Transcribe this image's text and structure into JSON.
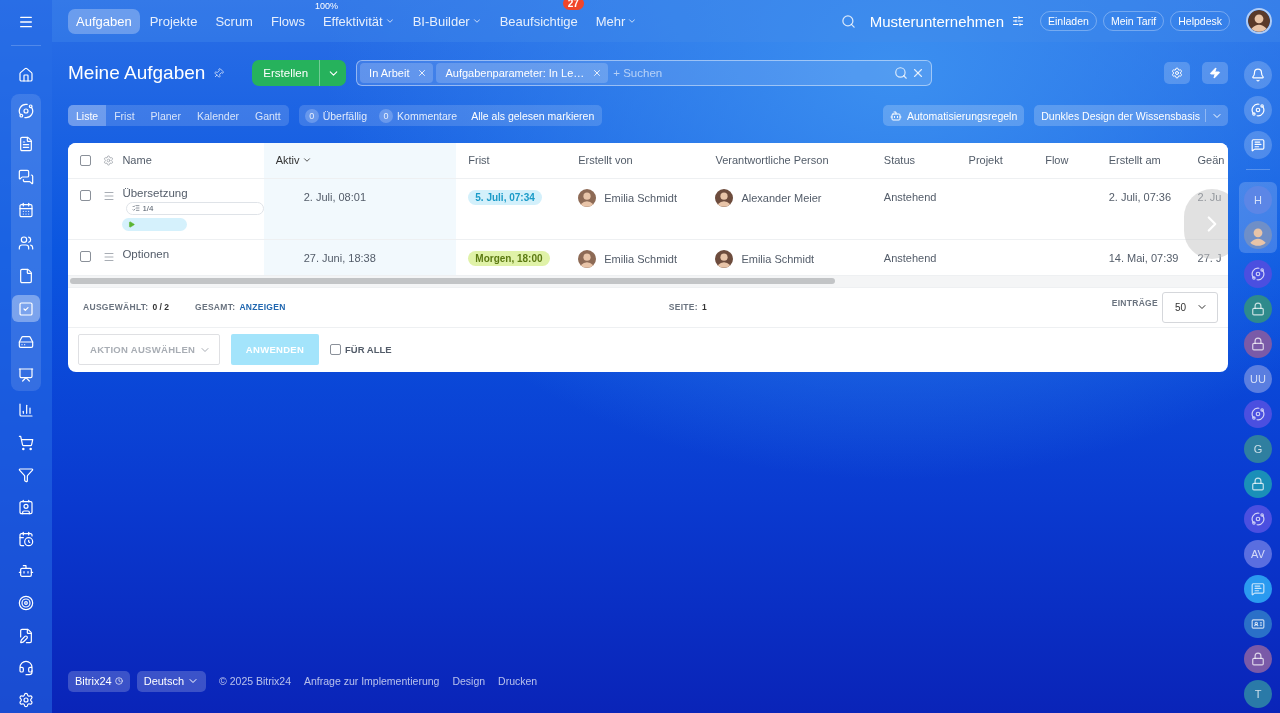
{
  "left_sidebar": {
    "top": [
      {
        "kind": "home",
        "selected": false
      }
    ],
    "group": [
      {
        "kind": "flow",
        "selected": false
      },
      {
        "kind": "news",
        "selected": false
      },
      {
        "kind": "chat",
        "selected": false
      },
      {
        "kind": "calendar",
        "selected": false
      },
      {
        "kind": "people",
        "selected": false
      },
      {
        "kind": "document",
        "selected": false
      },
      {
        "kind": "tasks",
        "selected": true
      },
      {
        "kind": "drive",
        "selected": false
      },
      {
        "kind": "board",
        "selected": false
      }
    ],
    "bottom": [
      {
        "kind": "chart",
        "selected": false
      },
      {
        "kind": "cart",
        "selected": false
      },
      {
        "kind": "funnel",
        "selected": false
      },
      {
        "kind": "contact",
        "selected": false
      },
      {
        "kind": "schedule",
        "selected": false
      },
      {
        "kind": "robot",
        "selected": false
      },
      {
        "kind": "target",
        "selected": false
      },
      {
        "kind": "sign",
        "selected": false
      },
      {
        "kind": "support",
        "selected": false
      },
      {
        "kind": "settings",
        "selected": false
      }
    ]
  },
  "top_nav": {
    "items": [
      {
        "label": "Aufgaben",
        "selected": true,
        "caret": false
      },
      {
        "label": "Projekte",
        "selected": false,
        "caret": false
      },
      {
        "label": "Scrum",
        "selected": false,
        "caret": false
      },
      {
        "label": "Flows",
        "selected": false,
        "caret": false
      },
      {
        "label": "Effektivität",
        "selected": false,
        "caret": true,
        "note": "100%"
      },
      {
        "label": "BI-Builder",
        "selected": false,
        "caret": true
      },
      {
        "label": "Beaufsichtige",
        "selected": false,
        "caret": false,
        "badge": "27"
      },
      {
        "label": "Mehr",
        "selected": false,
        "caret": true
      }
    ],
    "company": "Musterunternehmen",
    "buttons": [
      "Einladen",
      "Mein Tarif",
      "Helpdesk"
    ]
  },
  "header": {
    "title": "Meine Aufgaben",
    "create_button": "Erstellen",
    "filter": {
      "chips": [
        "In Arbeit",
        "Aufgabenparameter: In Le…"
      ],
      "placeholder": "+ Suchen"
    }
  },
  "view_tabs": [
    {
      "label": "Liste",
      "selected": true
    },
    {
      "label": "Frist",
      "selected": false
    },
    {
      "label": "Planer",
      "selected": false
    },
    {
      "label": "Kalender",
      "selected": false
    },
    {
      "label": "Gantt",
      "selected": false
    }
  ],
  "counters": [
    {
      "count": "0",
      "label": "Überfällig"
    },
    {
      "count": "0",
      "label": "Kommentare"
    }
  ],
  "mark_read": "Alle als gelesen markieren",
  "automation_button": "Automatisierungsregeln",
  "theme_button": "Dunkles Design der Wissensbasis",
  "table": {
    "header_checked": false,
    "columns": [
      {
        "label": "Name",
        "sorted": false
      },
      {
        "label": "Aktiv",
        "sorted": true
      },
      {
        "label": "Frist",
        "sorted": false
      },
      {
        "label": "Erstellt von",
        "sorted": false
      },
      {
        "label": "Verantwortliche Person",
        "sorted": false
      },
      {
        "label": "Status",
        "sorted": false
      },
      {
        "label": "Projekt",
        "sorted": false
      },
      {
        "label": "Flow",
        "sorted": false
      },
      {
        "label": "Erstellt am",
        "sorted": false
      },
      {
        "label": "Geän",
        "sorted": false
      }
    ],
    "rows": [
      {
        "checked": false,
        "name": "Übersetzung",
        "checklist": "1/4",
        "timer": true,
        "active": "2. Juli, 08:01",
        "deadline": {
          "text": "5. Juli, 07:34",
          "color": "#d3f0fb"
        },
        "created_by": "Emilia Schmidt",
        "responsible": "Alexander Meier",
        "status": "Anstehend",
        "created": "2. Juli, 07:36",
        "changed": "2. Ju"
      },
      {
        "checked": false,
        "name": "Optionen",
        "timer": false,
        "active": "27. Juni, 18:38",
        "deadline": {
          "text": "Morgen, 18:00",
          "color": "#e0f2a8"
        },
        "created_by": "Emilia Schmidt",
        "responsible": "Emilia Schmidt",
        "status": "Anstehend",
        "created": "14. Mai, 07:39",
        "changed": "27. J"
      }
    ]
  },
  "footer": {
    "selected_label": "AUSGEWÄHLT:",
    "selected_value": "0 / 2",
    "total_label": "GESAMT:",
    "total_link": "ANZEIGEN",
    "page_label": "SEITE:",
    "page": "1",
    "entries_label": "EINTRÄGE",
    "entries": "50",
    "action_placeholder": "AKTION AUSWÄHLEN",
    "apply": {
      "label": "ANWENDEN",
      "disabled": true
    },
    "for_all": {
      "label": "FÜR ALLE",
      "checked": false
    }
  },
  "right_sidebar": {
    "top": [
      {
        "kind": "bell"
      },
      {
        "kind": "swirl"
      },
      {
        "kind": "chat"
      }
    ],
    "pinned": [
      {
        "kind": "letter",
        "text": "H",
        "color": "#5c86e6"
      },
      {
        "kind": "avatar",
        "color": "#6f8fc8"
      }
    ],
    "items": [
      {
        "kind": "swirl",
        "color": "#4b4fe0"
      },
      {
        "kind": "lock",
        "color": "#2e8a8c"
      },
      {
        "kind": "lock",
        "color": "#7a5aa8"
      },
      {
        "kind": "letter",
        "text": "UU",
        "color": "#5a7ee0"
      },
      {
        "kind": "swirl",
        "color": "#4b4fe0"
      },
      {
        "kind": "letter",
        "text": "G",
        "color": "#2f7fa0"
      },
      {
        "kind": "lock",
        "color": "#1a8fb8"
      },
      {
        "kind": "swirl",
        "color": "#4b4fe0"
      },
      {
        "kind": "letter",
        "text": "AV",
        "color": "#5a6ee0"
      },
      {
        "kind": "chat",
        "color": "#2a9af0"
      },
      {
        "kind": "card",
        "color": "#2a70c8"
      },
      {
        "kind": "lock",
        "color": "#7a5aa8"
      },
      {
        "kind": "letter",
        "text": "T",
        "color": "#2a7aa8"
      }
    ]
  },
  "page_footer": {
    "brand": "Bitrix24",
    "language": "Deutsch",
    "copyright": "© 2025 Bitrix24",
    "links": [
      "Anfrage zur Implementierung",
      "Design",
      "Drucken"
    ]
  }
}
